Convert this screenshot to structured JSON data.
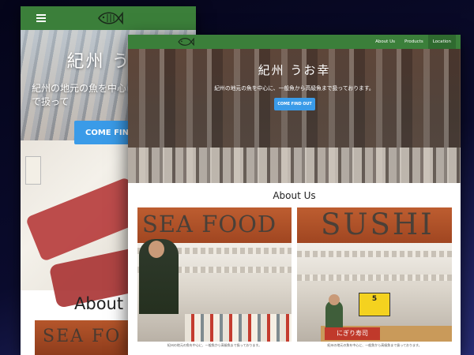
{
  "mobile": {
    "menu_icon": "hamburger-icon",
    "logo_icon": "fish-logo-icon",
    "hero_title": "紀州 うお",
    "hero_subtitle": "紀州の地元の魚を中心に ら高級魚まで扱って",
    "cta_label": "COME FIND OUT",
    "about_heading": "About U",
    "sign_text": "SEA FO"
  },
  "desktop": {
    "logo_icon": "fish-logo-icon",
    "nav": [
      {
        "label": "About Us",
        "active": false
      },
      {
        "label": "Products",
        "active": false
      },
      {
        "label": "Location",
        "active": true
      }
    ],
    "hero_title": "紀州 うお幸",
    "hero_subtitle": "紀州の地元の魚を中心に、一般魚から高級魚まで扱っております。",
    "cta_label": "COME FIND OUT",
    "about_heading": "About Us",
    "photos": [
      {
        "sign": "SEA FOOD",
        "caption": "紀州の地元の魚を中心に、一般魚から高級魚まで扱っております。"
      },
      {
        "sign": "SUSHI",
        "badge": "5",
        "counter_label": "にぎり寿司",
        "caption": "紀州の地元の魚を中心に、一般魚から高級魚まで扱っております。"
      }
    ]
  },
  "colors": {
    "nav_green": "#3b7f3a",
    "cta_blue": "#3a9be8",
    "sign_orange": "#b5562b"
  }
}
